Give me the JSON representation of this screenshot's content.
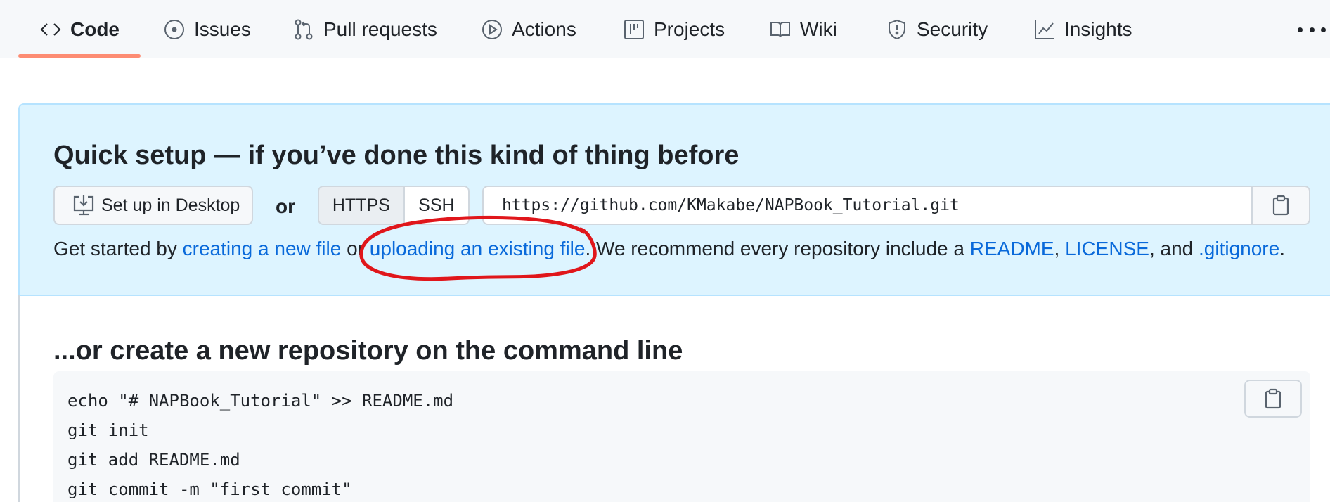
{
  "nav": {
    "items": [
      {
        "label": "Code",
        "icon": "code-icon",
        "selected": true
      },
      {
        "label": "Issues",
        "icon": "issue-opened-icon",
        "selected": false
      },
      {
        "label": "Pull requests",
        "icon": "git-pull-request-icon",
        "selected": false
      },
      {
        "label": "Actions",
        "icon": "play-icon",
        "selected": false
      },
      {
        "label": "Projects",
        "icon": "table-icon",
        "selected": false
      },
      {
        "label": "Wiki",
        "icon": "book-icon",
        "selected": false
      },
      {
        "label": "Security",
        "icon": "shield-icon",
        "selected": false
      },
      {
        "label": "Insights",
        "icon": "graph-icon",
        "selected": false
      }
    ],
    "more_icon": "kebab-horizontal-icon"
  },
  "quick_setup": {
    "title": "Quick setup — if you’ve done this kind of thing before",
    "desktop_button": "Set up in Desktop",
    "desktop_icon": "desktop-download-icon",
    "or_label": "or",
    "protocols": [
      "HTTPS",
      "SSH"
    ],
    "selected_protocol": "HTTPS",
    "clone_url": "https://github.com/KMakabe/NAPBook_Tutorial.git",
    "copy_icon": "clipboard-icon",
    "get_started": {
      "prefix": "Get started by ",
      "link_new_file": "creating a new file",
      "middle": " or ",
      "link_upload": "uploading an existing file",
      "recommend": ". We recommend every repository include a ",
      "link_readme": "README",
      "sep1": ", ",
      "link_license": "LICENSE",
      "sep2": ", and ",
      "link_gitignore": ".gitignore",
      "suffix": "."
    }
  },
  "annotation": {
    "color": "#e0161b",
    "note": "hand-drawn red circle"
  },
  "command_line": {
    "title": "...or create a new repository on the command line",
    "lines": [
      "echo \"# NAPBook_Tutorial\" >> README.md",
      "git init",
      "git add README.md",
      "git commit -m \"first commit\""
    ],
    "copy_icon": "clipboard-icon"
  },
  "colors": {
    "accent_link": "#0969da",
    "nav_underline": "#fd8c73",
    "setup_bg": "#ddf4ff",
    "annotation_red": "#e0161b"
  }
}
